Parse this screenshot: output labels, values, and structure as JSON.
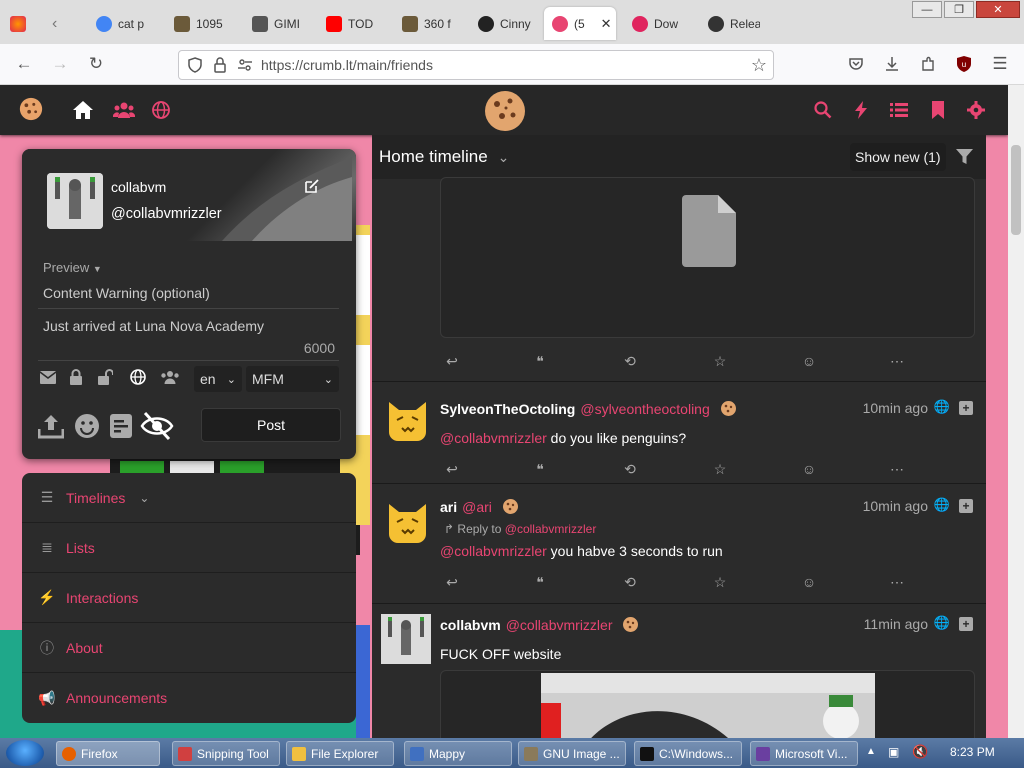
{
  "browser": {
    "tabs": [
      {
        "label": "cat p",
        "color": "#4285f4"
      },
      {
        "label": "1095",
        "color": "#6b5a3a"
      },
      {
        "label": "GIMI",
        "color": "#555555"
      },
      {
        "label": "TOD",
        "color": "#ff0000"
      },
      {
        "label": "360 f",
        "color": "#6b5a3a"
      },
      {
        "label": "Cinny",
        "color": "#222222"
      },
      {
        "label": "(5",
        "color": "#e84572"
      },
      {
        "label": "Dow",
        "color": "#e0245e"
      },
      {
        "label": "Relea",
        "color": "#333333"
      }
    ],
    "active_close": "✕",
    "url": "https://crumb.lt/main/friends"
  },
  "post_form": {
    "display_name": "collabvm",
    "handle": "@collabvmrizzler",
    "preview_label": "Preview",
    "cw_placeholder": "Content Warning (optional)",
    "body_text": "Just arrived at Luna Nova Academy",
    "char_count": "6000",
    "language": "en",
    "format": "MFM",
    "post_label": "Post"
  },
  "menu": {
    "items": [
      {
        "label": "Timelines",
        "icon": "bars-icon"
      },
      {
        "label": "Lists",
        "icon": "list-icon"
      },
      {
        "label": "Interactions",
        "icon": "bolt-icon"
      },
      {
        "label": "About",
        "icon": "info-icon"
      },
      {
        "label": "Announcements",
        "icon": "megaphone-icon"
      }
    ]
  },
  "timeline": {
    "title": "Home timeline",
    "show_new": "Show new (1)",
    "statuses": [
      {
        "name": "SylveonTheOctoling",
        "handle": "@sylveontheoctoling",
        "time": "10min ago",
        "mention": "@collabvmrizzler",
        "text": " do you like penguins?"
      },
      {
        "name": "ari",
        "handle": "@ari",
        "time": "10min ago",
        "reply_label": "Reply to",
        "reply_to": "@collabvmrizzler",
        "mention": "@collabvmrizzler",
        "text": " you habve 3 seconds to run"
      },
      {
        "name": "collabvm",
        "handle": "@collabvmrizzler",
        "time": "11min ago",
        "text": "FUCK OFF website"
      }
    ]
  },
  "taskbar": {
    "items": [
      {
        "label": "Firefox"
      },
      {
        "label": "Snipping Tool"
      },
      {
        "label": "File Explorer"
      },
      {
        "label": "Mappy"
      },
      {
        "label": "GNU Image ..."
      },
      {
        "label": "C:\\Windows..."
      },
      {
        "label": "Microsoft Vi..."
      }
    ],
    "clock": "8:23 PM"
  },
  "colors": {
    "accent": "#e84572",
    "panel": "#2b2b2b"
  }
}
